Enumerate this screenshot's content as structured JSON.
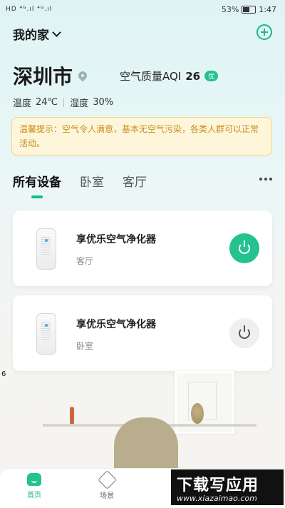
{
  "status_bar": {
    "left_icons_text": "HD ⁴ᴳ.ıl ⁴ᴳ.ıl",
    "battery": "53%",
    "time": "1:47"
  },
  "header": {
    "home_name": "我的家",
    "add_icon": "plus-circle-icon"
  },
  "location": {
    "city": "深圳市",
    "aqi_label": "空气质量AQI",
    "aqi_value": "26",
    "aqi_badge": "优",
    "temp_label": "温度",
    "temp_value": "24℃",
    "humidity_label": "湿度",
    "humidity_value": "30%"
  },
  "tip": {
    "text": "温馨提示：空气令人满意，基本无空气污染，各类人群可以正常活动。"
  },
  "tabs": [
    {
      "label": "所有设备",
      "active": true
    },
    {
      "label": "卧室",
      "active": false
    },
    {
      "label": "客厅",
      "active": false
    }
  ],
  "devices": [
    {
      "name": "享优乐空气净化器",
      "room": "客厅",
      "power": "on"
    },
    {
      "name": "享优乐空气净化器",
      "room": "卧室",
      "power": "off"
    }
  ],
  "stray_text": "6",
  "bottom_nav": [
    {
      "label": "首页",
      "icon": "home-icon",
      "active": true
    },
    {
      "label": "场景",
      "icon": "cube-icon",
      "active": false
    }
  ],
  "watermark": {
    "line1": "下载写应用",
    "line2": "www.xiazaimao.com"
  },
  "colors": {
    "accent": "#1bb98a",
    "tip_bg": "#fdf6db",
    "tip_text": "#cc8c1c"
  }
}
